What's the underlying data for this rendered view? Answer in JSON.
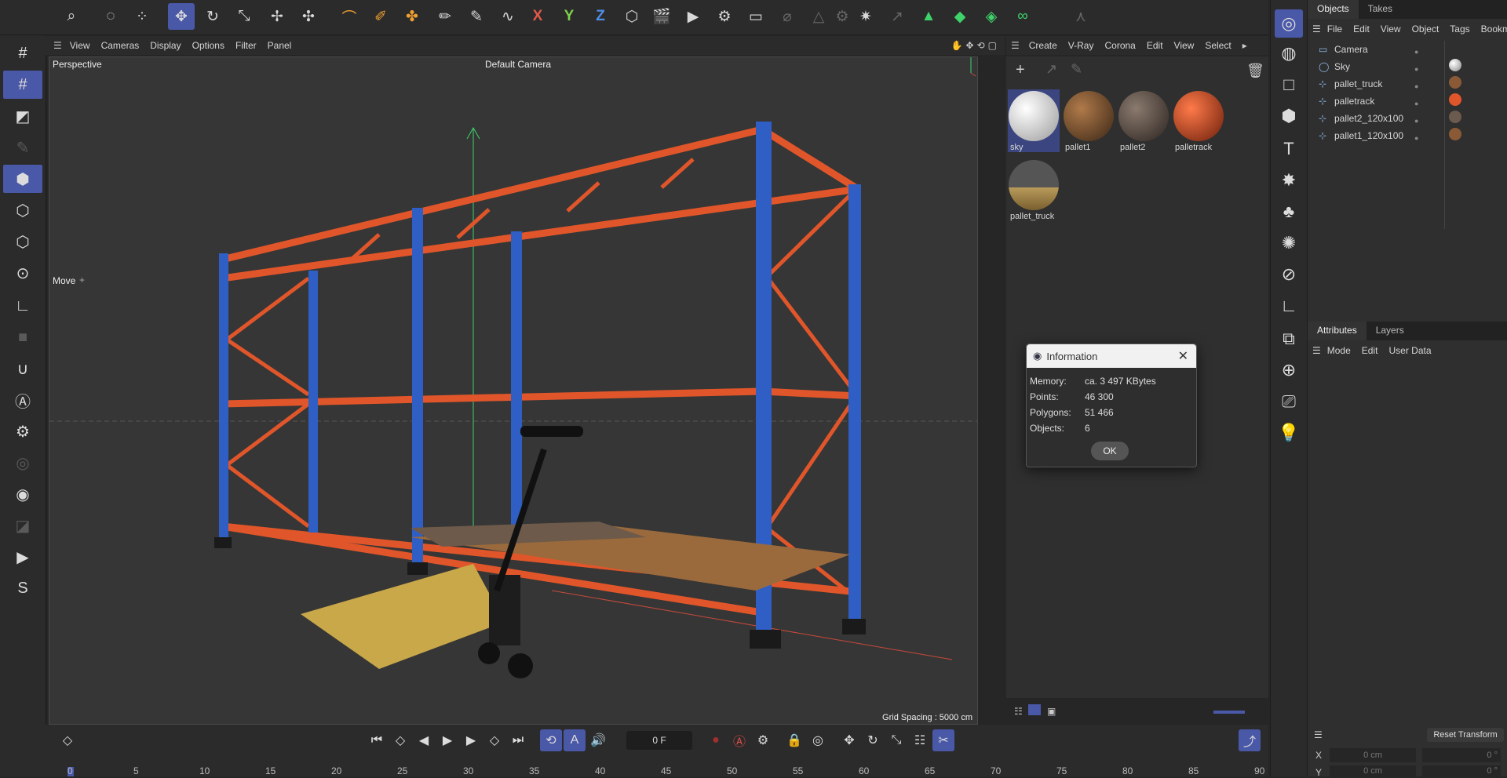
{
  "top_menu": {
    "view": "View",
    "cameras": "Cameras",
    "display": "Display",
    "options": "Options",
    "filter": "Filter",
    "panel": "Panel"
  },
  "viewport": {
    "name": "Perspective",
    "camera": "Default Camera",
    "tool": "Move",
    "grid_spacing": "Grid Spacing : 5000 cm"
  },
  "material_menu": {
    "create": "Create",
    "vray": "V-Ray",
    "corona": "Corona",
    "edit": "Edit",
    "view": "View",
    "select": "Select"
  },
  "materials": [
    {
      "name": "sky",
      "color": "#e8e8e8"
    },
    {
      "name": "pallet1",
      "color": "#8a5a36"
    },
    {
      "name": "pallet2",
      "color": "#6b5a4e"
    },
    {
      "name": "palletrack",
      "color": "#e0562a"
    },
    {
      "name": "pallet_truck",
      "color": "#4a4a4a"
    }
  ],
  "objects_tabs": {
    "objects": "Objects",
    "takes": "Takes"
  },
  "objects_menu": {
    "file": "File",
    "edit": "Edit",
    "view": "View",
    "object": "Object",
    "tags": "Tags",
    "bookmarks": "Bookm"
  },
  "objects": [
    {
      "name": "Camera",
      "icon": "camera-icon"
    },
    {
      "name": "Sky",
      "icon": "sky-icon"
    },
    {
      "name": "pallet_truck",
      "icon": "null-object-icon"
    },
    {
      "name": "palletrack",
      "icon": "null-object-icon"
    },
    {
      "name": "pallet2_120x100",
      "icon": "null-object-icon"
    },
    {
      "name": "pallet1_120x100",
      "icon": "null-object-icon"
    }
  ],
  "attributes_tabs": {
    "attributes": "Attributes",
    "layers": "Layers"
  },
  "attributes_menu": {
    "mode": "Mode",
    "edit": "Edit",
    "user_data": "User Data"
  },
  "transform": {
    "reset": "Reset Transform",
    "x_label": "X",
    "y_label": "Y",
    "x_value": "0 cm",
    "y_value": "0 cm",
    "x_rot": "0 °",
    "y_rot": "0 °"
  },
  "dialog": {
    "title": "Information",
    "rows": [
      {
        "label": "Memory:",
        "value": "ca. 3 497 KBytes"
      },
      {
        "label": "Points:",
        "value": "46 300"
      },
      {
        "label": "Polygons:",
        "value": "51 466"
      },
      {
        "label": "Objects:",
        "value": "6"
      }
    ],
    "ok": "OK"
  },
  "timeline": {
    "frame": "0 F",
    "ticks": [
      "0",
      "5",
      "10",
      "15",
      "20",
      "25",
      "30",
      "35",
      "40",
      "45",
      "50",
      "55",
      "60",
      "65",
      "70",
      "75",
      "80",
      "85",
      "90"
    ]
  },
  "colors": {
    "accent": "#4a58a8",
    "rack_orange": "#e0562a",
    "rack_blue": "#2f5fc4",
    "axis_green": "#3fd26a"
  }
}
